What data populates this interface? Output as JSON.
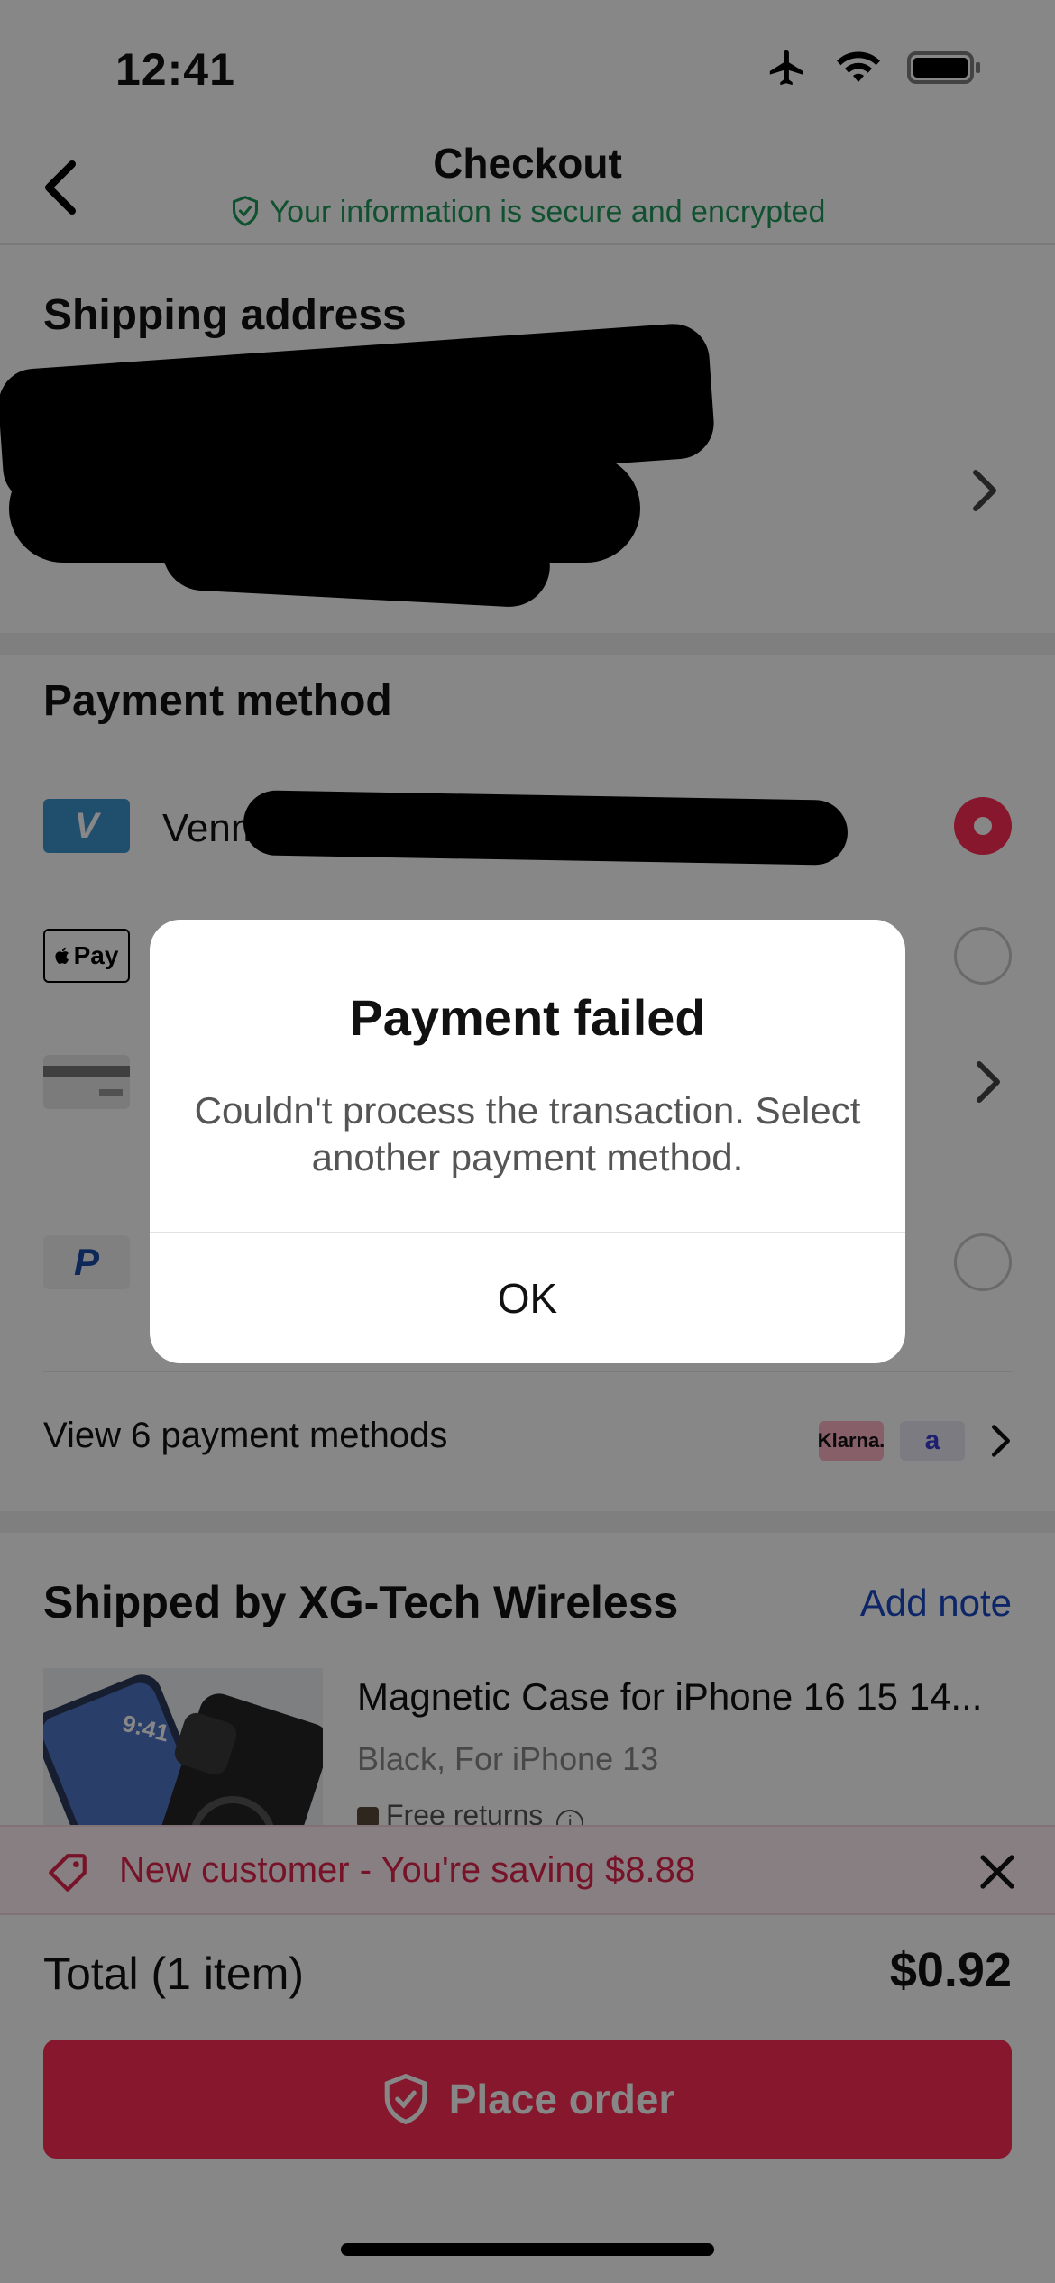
{
  "status_bar": {
    "time": "12:41",
    "icons": [
      "airplane-icon",
      "wifi-icon",
      "battery-icon"
    ]
  },
  "header": {
    "title": "Checkout",
    "secure_note": "Your information is secure and encrypted"
  },
  "shipping": {
    "title": "Shipping address"
  },
  "payment": {
    "title": "Payment method",
    "methods": [
      {
        "logo": "V",
        "label": "Venm",
        "selected": true
      },
      {
        "logo": "Pay",
        "label": "",
        "selected": false
      },
      {
        "logo": "card",
        "label": "",
        "selected": false
      },
      {
        "logo": "P",
        "label": "",
        "selected": false
      }
    ],
    "view_more": "View 6 payment methods",
    "badges": [
      "Klarna.",
      "a"
    ]
  },
  "shipment": {
    "title": "Shipped by XG-Tech Wireless",
    "add_note": "Add note",
    "product": {
      "name": "Magnetic Case for iPhone 16 15 14...",
      "variant": "Black, For iPhone 13",
      "returns": "Free returns",
      "image_time": "9:41"
    }
  },
  "promo": {
    "text": "New customer - You're saving $8.88"
  },
  "total": {
    "label": "Total",
    "count": "(1 item)",
    "amount": "$0.92"
  },
  "place_order": {
    "label": "Place order"
  },
  "dialog": {
    "title": "Payment failed",
    "message": "Couldn't process the transaction. Select another payment method.",
    "ok": "OK"
  },
  "colors": {
    "accent": "#fe2c55",
    "secure_green": "#1f9a5a",
    "link_blue": "#1a48c4",
    "overlay": "rgba(0,0,0,0.47)"
  }
}
